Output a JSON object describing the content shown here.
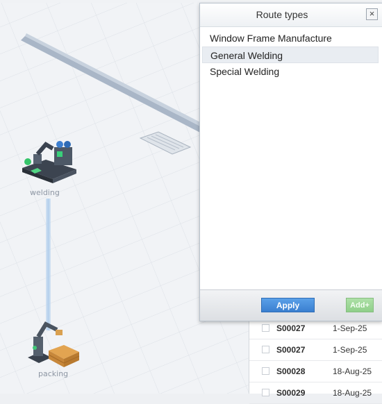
{
  "dialog": {
    "title": "Route types",
    "close_glyph": "×",
    "route_types": [
      "Window Frame Manufacture",
      "General Welding",
      "Special Welding"
    ],
    "selected_index": 1,
    "apply_label": "Apply",
    "add_label": "Add+"
  },
  "scene": {
    "nodes": [
      {
        "label": "welding",
        "icon": "welding-robot-icon"
      },
      {
        "label": "packing",
        "icon": "packing-robot-icon"
      }
    ]
  },
  "table": {
    "rows": [
      {
        "id": "S00027",
        "date": "1-Sep-25"
      },
      {
        "id": "S00027",
        "date": "1-Sep-25"
      },
      {
        "id": "S00028",
        "date": "18-Aug-25"
      },
      {
        "id": "S00029",
        "date": "18-Aug-25"
      }
    ]
  },
  "colors": {
    "apply_button": "#3a7fd0",
    "add_button": "#8fcf89",
    "connector": "#b4d1ee"
  }
}
